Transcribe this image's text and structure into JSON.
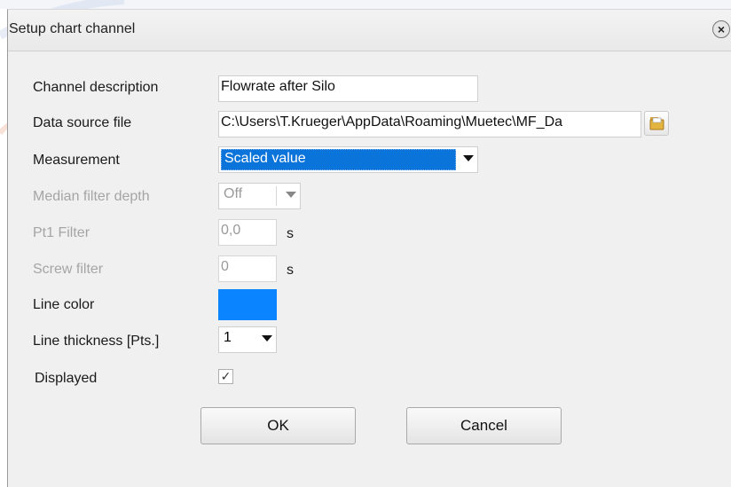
{
  "dialog": {
    "title": "Setup chart channel",
    "close_icon": "close-circle-icon"
  },
  "fields": {
    "channel_description": {
      "label": "Channel description",
      "value": "Flowrate after Silo"
    },
    "data_source_file": {
      "label": "Data source file",
      "value": "C:\\Users\\T.Krueger\\AppData\\Roaming\\Muetec\\MF_Da",
      "browse_icon": "folder-icon"
    },
    "measurement": {
      "label": "Measurement",
      "value": "Scaled value"
    },
    "median_filter_depth": {
      "label": "Median filter depth",
      "value": "Off"
    },
    "pt1_filter": {
      "label": "Pt1 Filter",
      "value": "0,0",
      "unit": "s"
    },
    "screw_filter": {
      "label": "Screw filter",
      "value": "0",
      "unit": "s"
    },
    "line_color": {
      "label": "Line color",
      "color": "#0a84ff"
    },
    "line_thickness": {
      "label": "Line thickness [Pts.]",
      "value": "1"
    },
    "displayed": {
      "label": "Displayed",
      "checked": true,
      "check_glyph": "✓"
    }
  },
  "buttons": {
    "ok": "OK",
    "cancel": "Cancel"
  },
  "colors": {
    "selection": "#0a74da",
    "disabled_text": "#a5a5a5"
  }
}
